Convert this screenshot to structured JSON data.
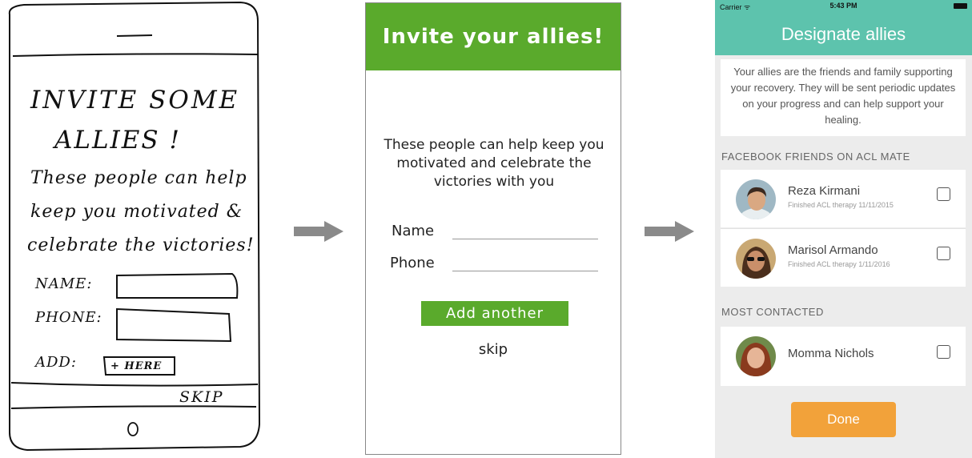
{
  "sketch": {
    "title_line1": "INVITE SOME",
    "title_line2": "ALLIES !",
    "body_line1": "These people can help",
    "body_line2": "keep you motivated &",
    "body_line3": "celebrate the victories!",
    "name_label": "NAME:",
    "phone_label": "PHONE:",
    "add_label": "ADD:",
    "add_button": "+ HERE",
    "skip": "SKIP"
  },
  "mockup": {
    "header": "Invite your allies!",
    "description": "These people can help keep you motivated and celebrate the victories with you",
    "name_label": "Name",
    "phone_label": "Phone",
    "add_button": "Add another",
    "skip": "skip",
    "accent_color": "#5aaa2c"
  },
  "app": {
    "status": {
      "carrier": "Carrier ᯤ",
      "time": "5:43 PM"
    },
    "title": "Designate allies",
    "intro": "Your allies are the friends and family supporting your recovery. They will be sent periodic updates on your progress and can help support your healing.",
    "section_facebook": "FACEBOOK FRIENDS ON ACL MATE",
    "section_most_contacted": "MOST CONTACTED",
    "contacts": [
      {
        "name": "Reza Kirmani",
        "subtitle": "Finished ACL therapy 11/11/2015",
        "checked": false
      },
      {
        "name": "Marisol Armando",
        "subtitle": "Finished ACL therapy 1/11/2016",
        "checked": false
      },
      {
        "name": "Momma Nichols",
        "subtitle": "",
        "checked": false
      }
    ],
    "done_button": "Done",
    "header_color": "#5dc3ad",
    "done_color": "#f2a23a"
  }
}
